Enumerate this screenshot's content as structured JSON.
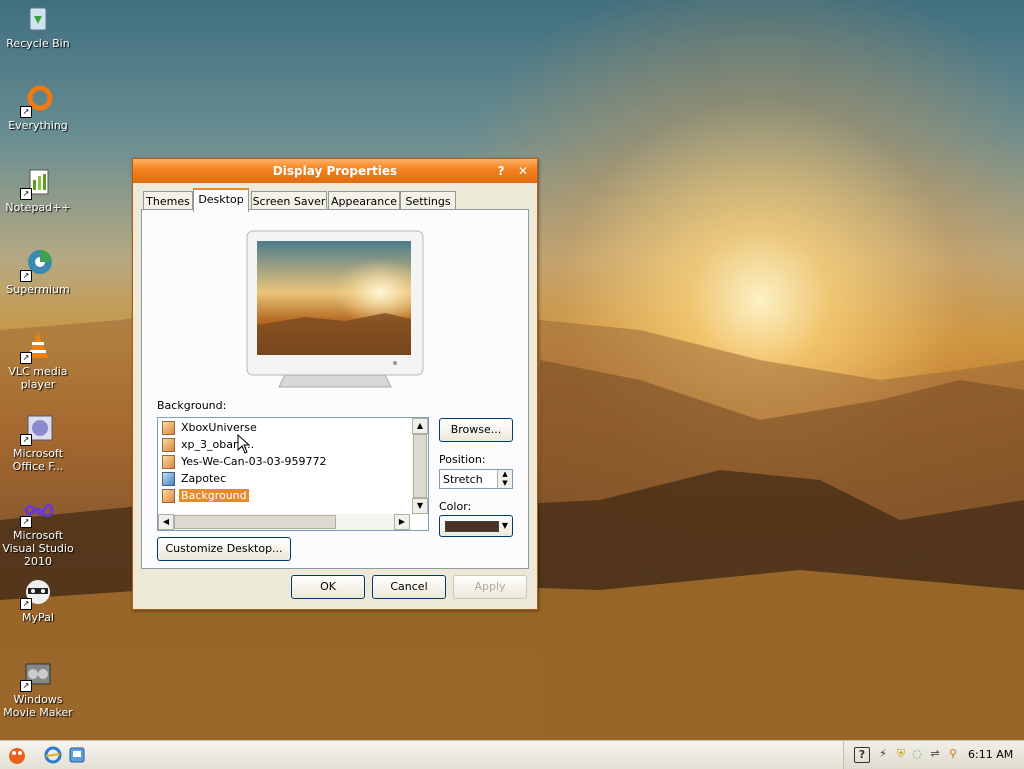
{
  "desktop_icons": [
    {
      "label": "Recycle Bin",
      "icon": "recycle-bin-icon"
    },
    {
      "label": "Everything",
      "icon": "everything-icon"
    },
    {
      "label": "Notepad++",
      "icon": "notepad-plus-plus-icon"
    },
    {
      "label": "Supermium",
      "icon": "supermium-icon"
    },
    {
      "label": "VLC media player",
      "icon": "vlc-icon"
    },
    {
      "label": "Microsoft Office F...",
      "icon": "office-icon"
    },
    {
      "label": "Microsoft Visual Studio 2010",
      "icon": "visual-studio-icon"
    },
    {
      "label": "MyPal",
      "icon": "mypal-icon"
    },
    {
      "label": "Windows Movie Maker",
      "icon": "movie-maker-icon"
    }
  ],
  "dialog": {
    "title": "Display Properties",
    "help_glyph": "?",
    "close_glyph": "✕",
    "tabs": [
      "Themes",
      "Desktop",
      "Screen Saver",
      "Appearance",
      "Settings"
    ],
    "active_tab": "Desktop",
    "background_label": "Background:",
    "backgrounds": [
      "XboxUniverse",
      "xp_3_obam...",
      "Yes-We-Can-03-03-959772",
      "Zapotec",
      "Background"
    ],
    "selected_background": "Background",
    "browse_label": "Browse...",
    "position_label": "Position:",
    "position_value": "Stretch",
    "color_label": "Color:",
    "color_value": "#4a3324",
    "customize_label": "Customize Desktop...",
    "ok_label": "OK",
    "cancel_label": "Cancel",
    "apply_label": "Apply"
  },
  "taskbar": {
    "clock": "6:11 AM"
  }
}
